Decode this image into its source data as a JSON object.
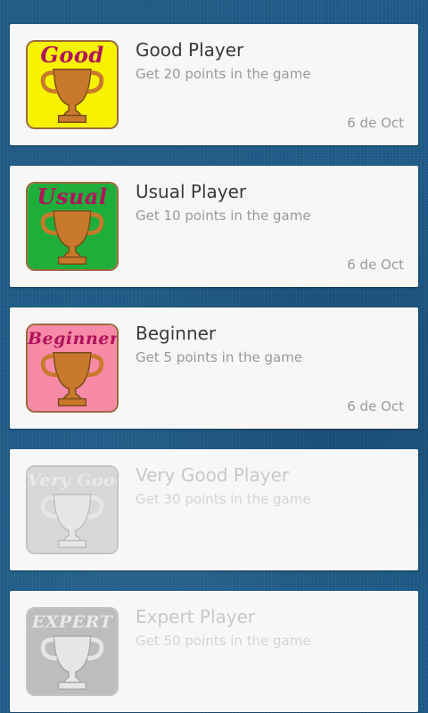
{
  "achievements": [
    {
      "badge_word": "Good",
      "title": "Good Player",
      "description": "Get 20 points in the game",
      "date": "6 de Oct",
      "unlocked": true,
      "badge_color": "#f7f300"
    },
    {
      "badge_word": "Usual",
      "title": "Usual Player",
      "description": "Get 10 points in the game",
      "date": "6 de Oct",
      "unlocked": true,
      "badge_color": "#1fae3a"
    },
    {
      "badge_word": "Beginner",
      "title": "Beginner",
      "description": "Get 5 points in the game",
      "date": "6 de Oct",
      "unlocked": true,
      "badge_color": "#f78aa6"
    },
    {
      "badge_word": "Very Good",
      "title": "Very Good Player",
      "description": "Get 30 points in the game",
      "date": "",
      "unlocked": false,
      "badge_color": "#d8d8d8"
    },
    {
      "badge_word": "EXPERT",
      "title": "Expert Player",
      "description": "Get 50 points in the game",
      "date": "",
      "unlocked": false,
      "badge_color": "#bdbdbd"
    }
  ],
  "icons": {
    "trophy": "trophy-icon"
  },
  "colors": {
    "trophy_gold": "#c8792c",
    "trophy_locked": "#e6e6e6",
    "badge_text": "#b0125c",
    "background": "#1f5d8a"
  }
}
